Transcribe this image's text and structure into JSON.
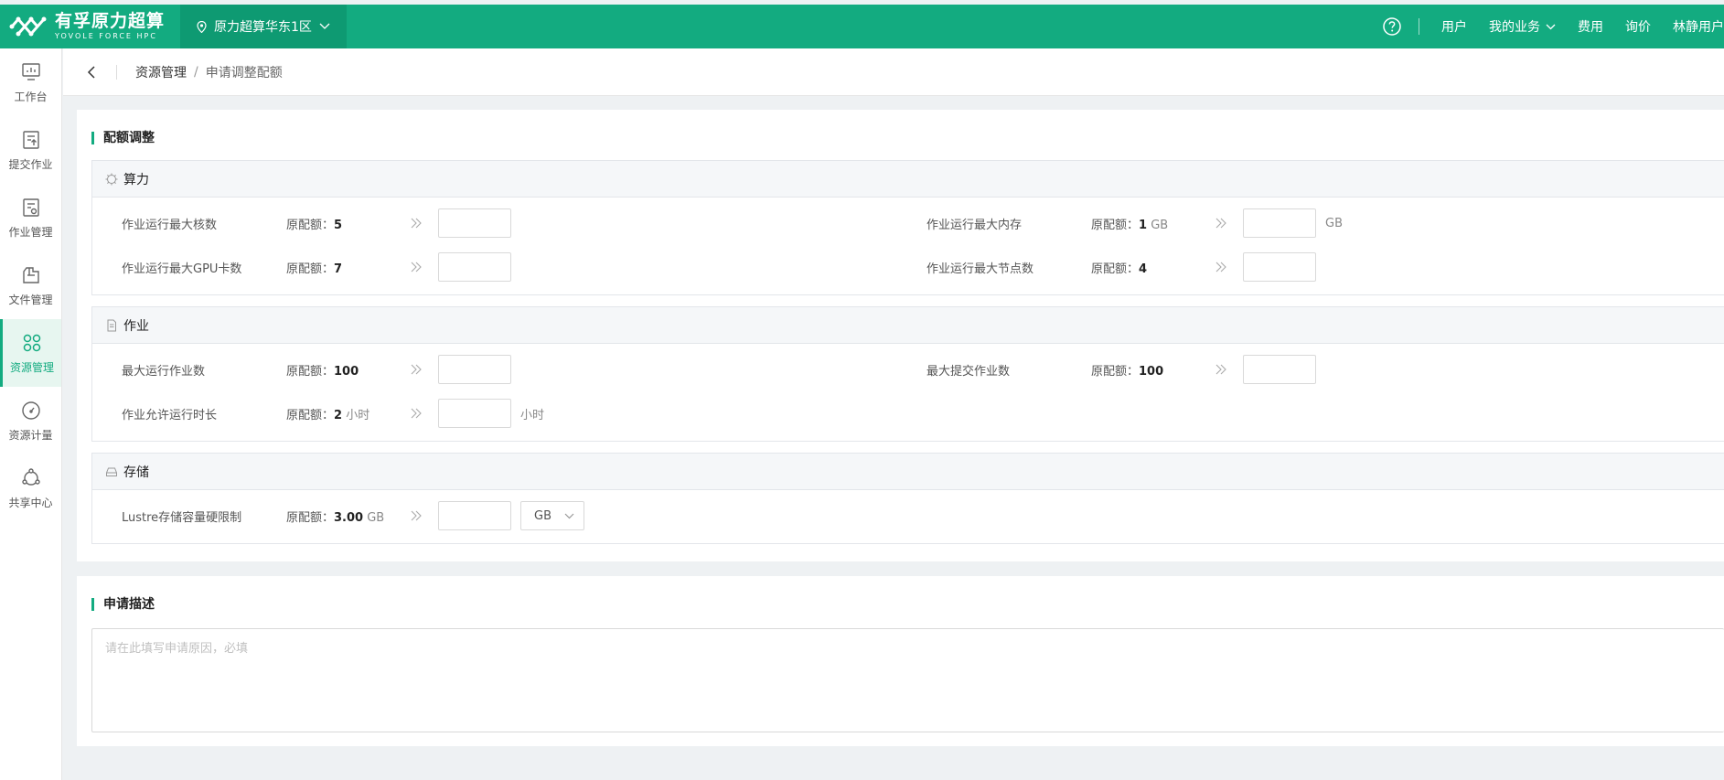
{
  "header": {
    "logo_cn": "有孚原力超算",
    "logo_en": "YOVOLE FORCE HPC",
    "region": "原力超算华东1区",
    "nav": [
      "用户",
      "我的业务",
      "费用",
      "询价",
      "林静用户"
    ]
  },
  "sidebar": {
    "items": [
      {
        "label": "工作台",
        "icon": "monitor-icon"
      },
      {
        "label": "提交作业",
        "icon": "upload-doc-icon"
      },
      {
        "label": "作业管理",
        "icon": "doc-gear-icon"
      },
      {
        "label": "文件管理",
        "icon": "folder-icon"
      },
      {
        "label": "资源管理",
        "icon": "grid-circles-icon"
      },
      {
        "label": "资源计量",
        "icon": "gauge-icon"
      },
      {
        "label": "共享中心",
        "icon": "share-icon"
      }
    ],
    "active": "资源管理"
  },
  "breadcrumb": {
    "root": "资源管理",
    "sep": "/",
    "current": "申请调整配额"
  },
  "quota": {
    "title": "配额调整",
    "orig_label": "原配额：",
    "compute": {
      "title": "算力",
      "rows": [
        {
          "label": "作业运行最大核数",
          "orig": "5",
          "unit": ""
        },
        {
          "label": "作业运行最大内存",
          "orig": "1",
          "unit": "GB",
          "after": "GB"
        },
        {
          "label": "作业运行最大GPU卡数",
          "orig": "7",
          "unit": ""
        },
        {
          "label": "作业运行最大节点数",
          "orig": "4",
          "unit": ""
        }
      ]
    },
    "job": {
      "title": "作业",
      "rows": [
        {
          "label": "最大运行作业数",
          "orig": "100",
          "unit": ""
        },
        {
          "label": "最大提交作业数",
          "orig": "100",
          "unit": ""
        },
        {
          "label": "作业允许运行时长",
          "orig": "2",
          "unit": "小时",
          "after": "小时"
        }
      ]
    },
    "storage": {
      "title": "存储",
      "rows": [
        {
          "label": "Lustre存储容量硬限制",
          "orig": "3.00",
          "unit": "GB",
          "select": "GB"
        }
      ]
    }
  },
  "description": {
    "title": "申请描述",
    "placeholder": "请在此填写申请原因，必填"
  },
  "colors": {
    "brand": "#13ab80",
    "brand_dark": "#0e9a72"
  }
}
